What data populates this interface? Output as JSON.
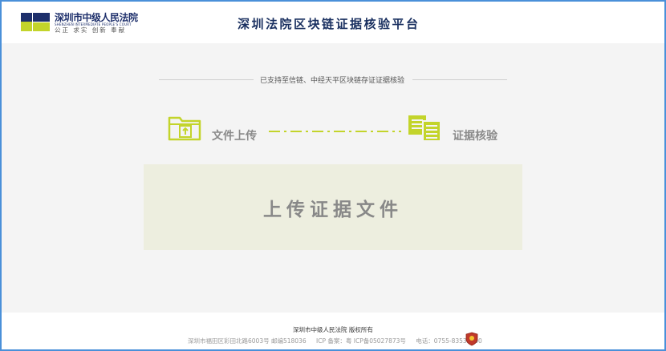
{
  "header": {
    "court_name": "深圳市中级人民法院",
    "court_name_en": "SHENZHEN INTERMEDIATE PEOPLE'S COURT",
    "motto": "公正 求实 创新 奉献",
    "site_title": "深圳法院区块链证据核验平台"
  },
  "main": {
    "support_text": "已支持至信链、中经天平区块链存证证据核验",
    "steps": [
      {
        "label": "文件上传",
        "icon": "folder-upload-icon"
      },
      {
        "label": "证据核验",
        "icon": "documents-icon"
      }
    ],
    "upload_button_label": "上传证据文件"
  },
  "footer": {
    "copyright": "深圳市中级人民法院 版权所有",
    "address": "深圳市福田区彩田北路6003号 邮编518036",
    "icp": "ICP 备案：粤 ICP备05027873号",
    "phone": "电话：0755-83535000"
  },
  "colors": {
    "accent_green": "#c3d42b",
    "title_navy": "#1a3060",
    "upload_bg": "#edeedf",
    "frame_border": "#4a90d9"
  }
}
